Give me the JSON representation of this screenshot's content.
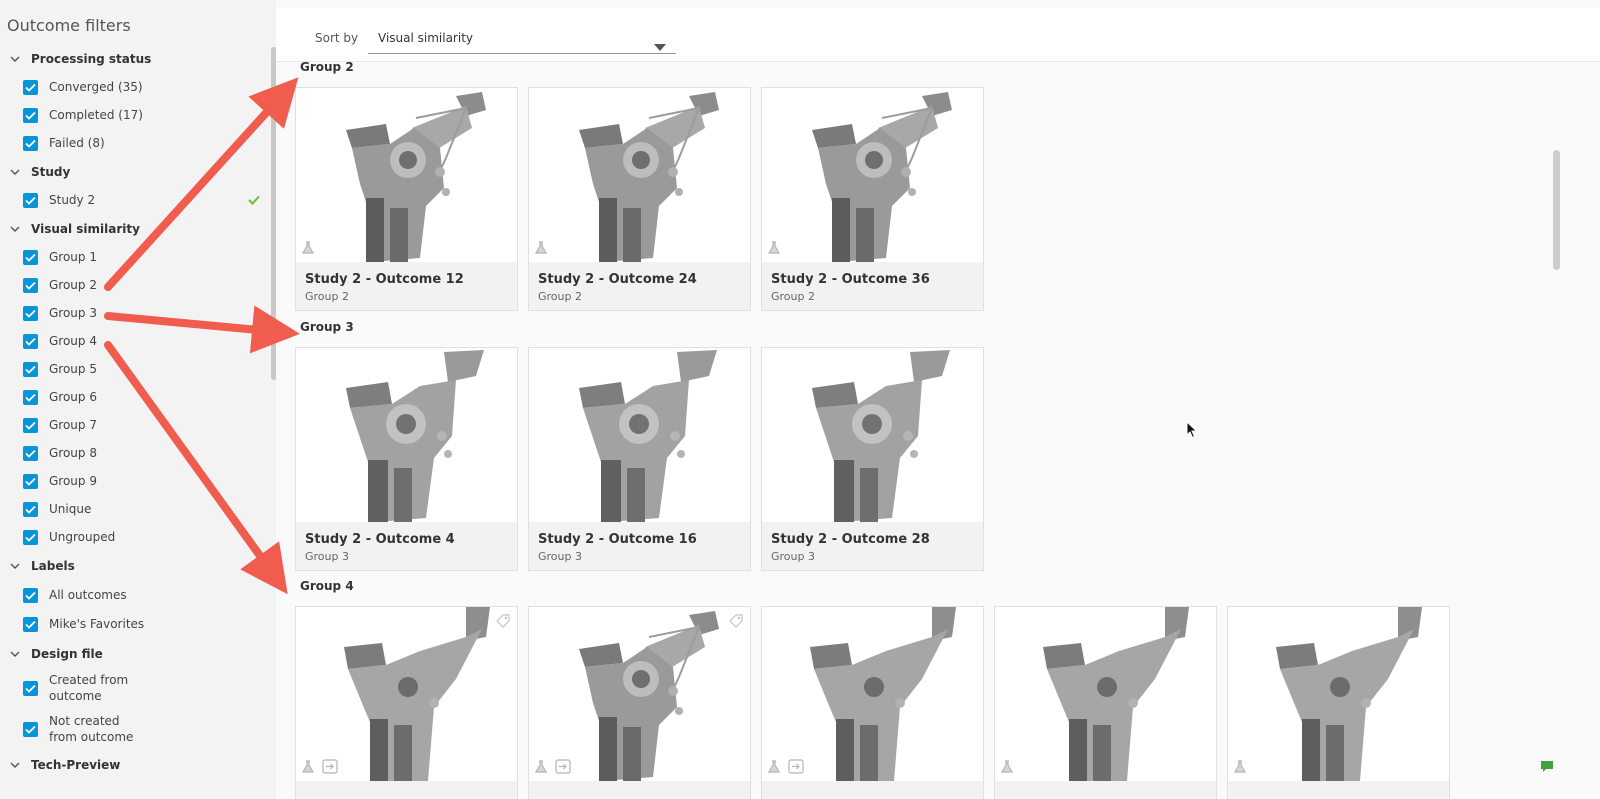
{
  "sidebar": {
    "title": "Outcome filters",
    "sections": [
      {
        "label": "Processing status",
        "items": [
          "Converged (35)",
          "Completed (17)",
          "Failed (8)"
        ]
      },
      {
        "label": "Study",
        "items": [
          "Study 2"
        ]
      },
      {
        "label": "Visual similarity",
        "items": [
          "Group 1",
          "Group 2",
          "Group 3",
          "Group 4",
          "Group 5",
          "Group 6",
          "Group 7",
          "Group 8",
          "Group 9",
          "Unique",
          "Ungrouped"
        ]
      },
      {
        "label": "Labels",
        "items": [
          "All outcomes",
          "Mike's Favorites"
        ]
      },
      {
        "label": "Design file",
        "items": [
          "Created from outcome",
          "Not created from outcome"
        ]
      },
      {
        "label": "Tech-Preview",
        "items": []
      }
    ]
  },
  "sort": {
    "label": "Sort by",
    "value": "Visual similarity"
  },
  "groups": [
    {
      "title": "Group 2",
      "cards": [
        {
          "name": "Study 2 - Outcome 12",
          "group": "Group 2"
        },
        {
          "name": "Study 2 - Outcome 24",
          "group": "Group 2"
        },
        {
          "name": "Study 2 - Outcome 36",
          "group": "Group 2"
        }
      ]
    },
    {
      "title": "Group 3",
      "cards": [
        {
          "name": "Study 2 - Outcome 4",
          "group": "Group 3"
        },
        {
          "name": "Study 2 - Outcome 16",
          "group": "Group 3"
        },
        {
          "name": "Study 2 - Outcome 28",
          "group": "Group 3"
        }
      ]
    },
    {
      "title": "Group 4",
      "cards": [
        {
          "name": "",
          "group": ""
        },
        {
          "name": "",
          "group": ""
        },
        {
          "name": "",
          "group": ""
        },
        {
          "name": "",
          "group": ""
        },
        {
          "name": "",
          "group": ""
        }
      ]
    }
  ],
  "colors": {
    "accent": "#0696d7",
    "check": "#6abf2c",
    "arrow": "#f05c4e"
  }
}
